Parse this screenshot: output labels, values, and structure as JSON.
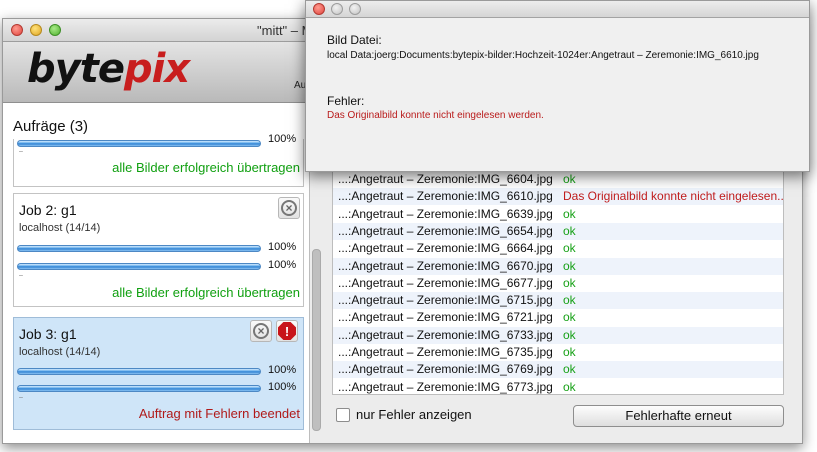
{
  "window": {
    "title": "\"mitt\" – M"
  },
  "toolbar": {
    "logo_left": "byte",
    "logo_right": "pix",
    "right_text": "Au"
  },
  "left_panel": {
    "header": "Aufräge (3)",
    "job1": {
      "pct": "100%",
      "status": "alle Bilder erfolgreich übertragen"
    },
    "job2": {
      "title": "Job 2: g1",
      "sub": "localhost (14/14)",
      "pct1": "100%",
      "pct2": "100%",
      "status": "alle Bilder erfolgreich übertragen"
    },
    "job3": {
      "title": "Job 3: g1",
      "sub": "localhost (14/14)",
      "pct1": "100%",
      "pct2": "100%",
      "status": "Auftrag mit Fehlern beendet"
    }
  },
  "file_list": [
    {
      "name": "...:Angetraut – Zeremonie:IMG_6604.jpg",
      "result": "ok",
      "error": false
    },
    {
      "name": "...:Angetraut – Zeremonie:IMG_6610.jpg",
      "result": "Das Originalbild konnte nicht eingelesen...",
      "error": true
    },
    {
      "name": "...:Angetraut – Zeremonie:IMG_6639.jpg",
      "result": "ok",
      "error": false
    },
    {
      "name": "...:Angetraut – Zeremonie:IMG_6654.jpg",
      "result": "ok",
      "error": false
    },
    {
      "name": "...:Angetraut – Zeremonie:IMG_6664.jpg",
      "result": "ok",
      "error": false
    },
    {
      "name": "...:Angetraut – Zeremonie:IMG_6670.jpg",
      "result": "ok",
      "error": false
    },
    {
      "name": "...:Angetraut – Zeremonie:IMG_6677.jpg",
      "result": "ok",
      "error": false
    },
    {
      "name": "...:Angetraut – Zeremonie:IMG_6715.jpg",
      "result": "ok",
      "error": false
    },
    {
      "name": "...:Angetraut – Zeremonie:IMG_6721.jpg",
      "result": "ok",
      "error": false
    },
    {
      "name": "...:Angetraut – Zeremonie:IMG_6733.jpg",
      "result": "ok",
      "error": false
    },
    {
      "name": "...:Angetraut – Zeremonie:IMG_6735.jpg",
      "result": "ok",
      "error": false
    },
    {
      "name": "...:Angetraut – Zeremonie:IMG_6769.jpg",
      "result": "ok",
      "error": false
    },
    {
      "name": "...:Angetraut – Zeremonie:IMG_6773.jpg",
      "result": "ok",
      "error": false
    }
  ],
  "controls": {
    "checkbox_label": "nur Fehler anzeigen",
    "retry_button": "Fehlerhafte erneut"
  },
  "popup": {
    "file_label": "Bild Datei:",
    "file_path": "local Data:joerg:Documents:bytepix-bilder:Hochzeit-1024er:Angetraut – Zeremonie:IMG_6610.jpg",
    "error_label": "Fehler:",
    "error_text": "Das Originalbild konnte nicht eingelesen werden."
  },
  "colors": {
    "ok": "#17a117",
    "error": "#c01d1d",
    "selection": "#cfe5f8",
    "progress": "#3d8ee0"
  },
  "icons": {
    "cancel": "cancel-circle-icon",
    "warning": "warning-octagon-icon"
  }
}
